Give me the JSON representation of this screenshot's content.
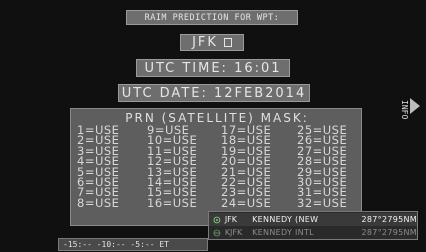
{
  "title": "RAIM PREDICTION FOR WPT:",
  "waypoint": "JFK",
  "utc_time": "UTC TIME: 16:01",
  "utc_date": "UTC DATE: 12FEB2014",
  "prn": {
    "title": "PRN (SATELLITE) MASK:",
    "columns": [
      [
        "1=USE",
        "2=USE",
        "3=USE",
        "4=USE",
        "5=USE",
        "6=USE",
        "7=USE",
        "8=USE"
      ],
      [
        "9=USE",
        "10=USE",
        "11=USE",
        "12=USE",
        "13=USE",
        "14=USE",
        "15=USE",
        "16=USE"
      ],
      [
        "17=USE",
        "18=USE",
        "19=USE",
        "20=USE",
        "21=USE",
        "22=USE",
        "23=USE",
        "24=USE"
      ],
      [
        "25=USE",
        "26=USE",
        "27=USE",
        "28=USE",
        "29=USE",
        "30=USE",
        "31=USE",
        "32=USE"
      ]
    ]
  },
  "info_label": "INFO",
  "timeline": "-15:-- -10:-- -5:-- ET",
  "dropdown": [
    {
      "id": "JFK",
      "name": "KENNEDY (NEW",
      "bearing": "287°2795NM",
      "icon": "nav-icon"
    },
    {
      "id": "KJFK",
      "name": "KENNEDY INTL",
      "bearing": "287°2795NM",
      "icon": "airport-icon"
    }
  ],
  "colors": {
    "screen_bg": "#101010",
    "panel": "#5e5e5e",
    "box": "#6e6e6e",
    "text": "#d8d8d8"
  }
}
